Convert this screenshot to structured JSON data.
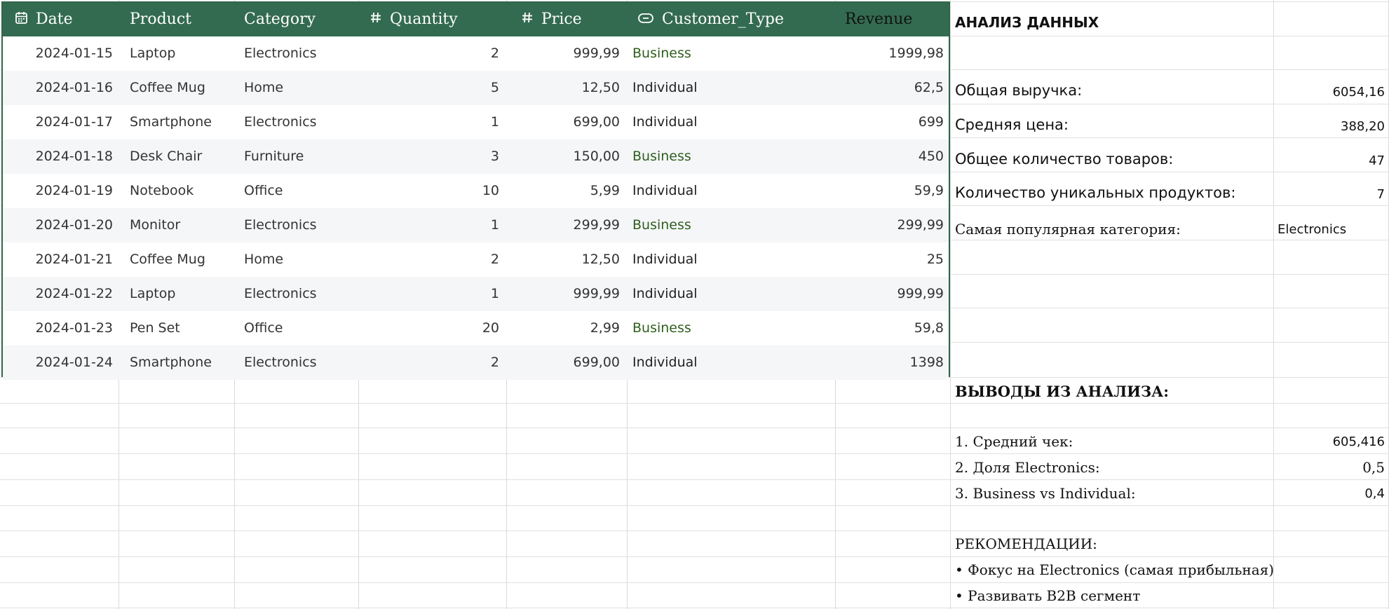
{
  "table": {
    "headers": {
      "date": "Date",
      "product": "Product",
      "category": "Category",
      "quantity": "Quantity",
      "price": "Price",
      "customer_type": "Customer_Type",
      "revenue": "Revenue"
    },
    "header_icons": {
      "date": "calendar-icon",
      "quantity": "hash-icon",
      "price": "hash-icon",
      "customer_type": "toggle-icon"
    },
    "rows": [
      {
        "date": "2024-01-15",
        "product": "Laptop",
        "category": "Electronics",
        "quantity": "2",
        "price": "999,99",
        "customer_type": "Business",
        "revenue": "1999,98"
      },
      {
        "date": "2024-01-16",
        "product": "Coffee Mug",
        "category": "Home",
        "quantity": "5",
        "price": "12,50",
        "customer_type": "Individual",
        "revenue": "62,5"
      },
      {
        "date": "2024-01-17",
        "product": "Smartphone",
        "category": "Electronics",
        "quantity": "1",
        "price": "699,00",
        "customer_type": "Individual",
        "revenue": "699"
      },
      {
        "date": "2024-01-18",
        "product": "Desk Chair",
        "category": "Furniture",
        "quantity": "3",
        "price": "150,00",
        "customer_type": "Business",
        "revenue": "450"
      },
      {
        "date": "2024-01-19",
        "product": "Notebook",
        "category": "Office",
        "quantity": "10",
        "price": "5,99",
        "customer_type": "Individual",
        "revenue": "59,9"
      },
      {
        "date": "2024-01-20",
        "product": "Monitor",
        "category": "Electronics",
        "quantity": "1",
        "price": "299,99",
        "customer_type": "Business",
        "revenue": "299,99"
      },
      {
        "date": "2024-01-21",
        "product": "Coffee Mug",
        "category": "Home",
        "quantity": "2",
        "price": "12,50",
        "customer_type": "Individual",
        "revenue": "25"
      },
      {
        "date": "2024-01-22",
        "product": "Laptop",
        "category": "Electronics",
        "quantity": "1",
        "price": "999,99",
        "customer_type": "Individual",
        "revenue": "999,99"
      },
      {
        "date": "2024-01-23",
        "product": "Pen Set",
        "category": "Office",
        "quantity": "20",
        "price": "2,99",
        "customer_type": "Business",
        "revenue": "59,8"
      },
      {
        "date": "2024-01-24",
        "product": "Smartphone",
        "category": "Electronics",
        "quantity": "2",
        "price": "699,00",
        "customer_type": "Individual",
        "revenue": "1398"
      }
    ]
  },
  "analysis": {
    "title": "АНАЛИЗ ДАННЫХ",
    "total_revenue_label": "Общая выручка:",
    "total_revenue_value": "6054,16",
    "avg_price_label": "Средняя цена:",
    "avg_price_value": "388,20",
    "total_qty_label": "Общее количество товаров:",
    "total_qty_value": "47",
    "unique_products_label": "Количество уникальных продуктов:",
    "unique_products_value": "7",
    "popular_category_label": "Самая популярная категория:",
    "popular_category_value": "Electronics"
  },
  "conclusions": {
    "title": "ВЫВОДЫ ИЗ АНАЛИЗА:",
    "avg_check_label": "1. Средний чек:",
    "avg_check_value": "605,416",
    "electronics_share_label": "2. Доля Electronics:",
    "electronics_share_value": "0,5",
    "business_vs_individual_label": "3. Business vs Individual:",
    "business_vs_individual_value": "0,4"
  },
  "recommendations": {
    "title": "РЕКОМЕНДАЦИИ:",
    "items": [
      "• Фокус на Electronics (самая прибыльная)",
      "• Развивать B2B сегмент"
    ]
  },
  "colors": {
    "header_bg": "#336b50",
    "table_border": "#2f6548",
    "business_text": "#2f5e1e",
    "alt_row": "#f5f6f8"
  }
}
